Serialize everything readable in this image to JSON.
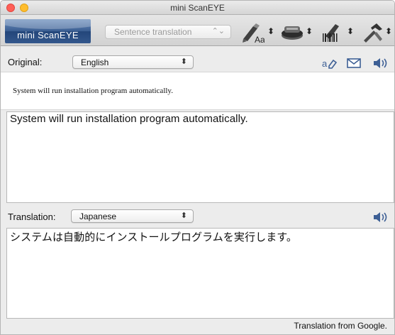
{
  "window": {
    "title": "mini ScanEYE"
  },
  "toolbar": {
    "brand": "mini ScanEYE",
    "mode": "Sentence translation",
    "tools": [
      "pen-font-icon",
      "scanner-icon",
      "barcode-pen-icon",
      "tools-icon"
    ]
  },
  "original": {
    "label": "Original:",
    "language": "English",
    "scanned_text": "System will run installation program automatically.",
    "recognized_text": "System will run installation program automatically."
  },
  "translation": {
    "label": "Translation:",
    "language": "Japanese",
    "text": "システムは自動的にインストールプログラムを実行します。"
  },
  "footer": {
    "credit": "Translation from Google."
  },
  "colors": {
    "brand_blue": "#33578c",
    "close": "#ff5f57",
    "minimize": "#ffbd2e"
  }
}
